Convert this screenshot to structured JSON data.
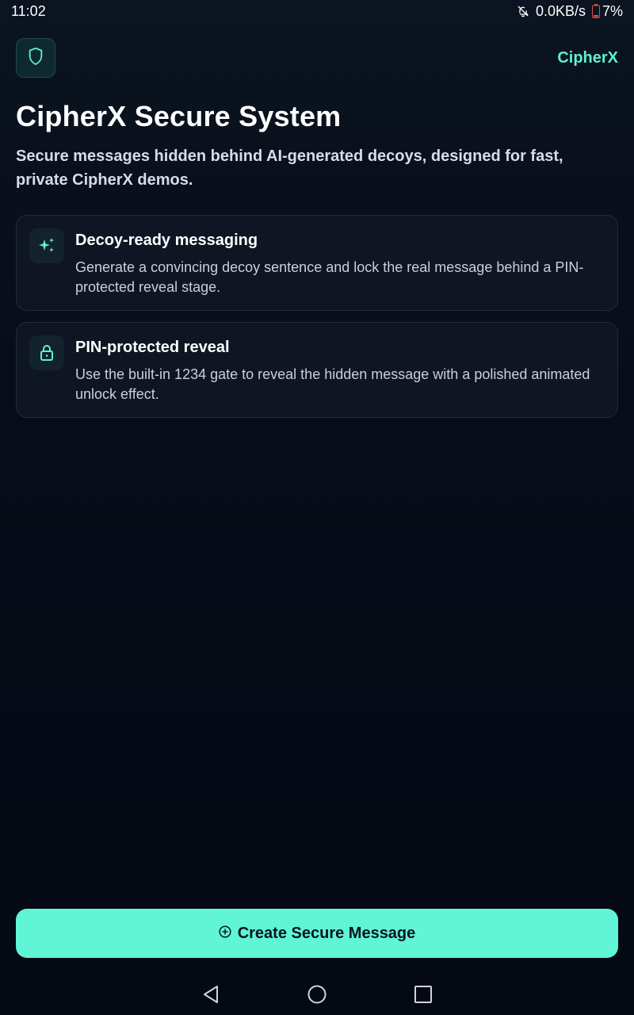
{
  "status_bar": {
    "time": "11:02",
    "network_speed": "0.0KB/s",
    "battery": "7%",
    "icons": [
      "notifications-off-icon",
      "battery-icon"
    ]
  },
  "header": {
    "logo_icon": "shield-icon",
    "brand": "CipherX"
  },
  "hero": {
    "title": "CipherX Secure System",
    "subtitle": "Secure messages hidden behind AI-generated decoys, designed for fast, private CipherX demos."
  },
  "features": [
    {
      "icon": "sparkles-icon",
      "title": "Decoy-ready messaging",
      "description": "Generate a convincing decoy sentence and lock the real message behind a PIN-protected reveal stage."
    },
    {
      "icon": "lock-icon",
      "title": "PIN-protected reveal",
      "description": "Use the built-in 1234 gate to reveal the hidden message with a polished animated unlock effect."
    }
  ],
  "cta": {
    "icon": "plus-circle-icon",
    "label": "Create Secure Message"
  },
  "colors": {
    "accent": "#5ff5d6",
    "background": "#060b16",
    "card": "#0f1523"
  },
  "nav": [
    "back-icon",
    "home-icon",
    "recents-icon"
  ]
}
